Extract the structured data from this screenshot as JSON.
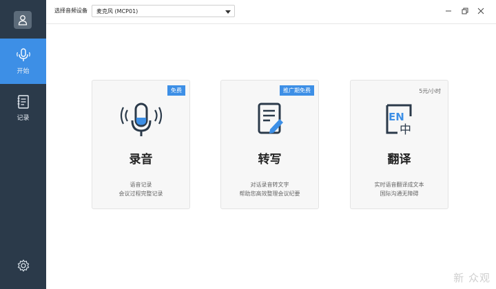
{
  "header": {
    "device_label": "选择音频设备",
    "device_value": "麦克风 (MCP01)"
  },
  "sidebar": {
    "items": [
      {
        "label": "开始",
        "icon": "microphone-icon",
        "active": true
      },
      {
        "label": "记录",
        "icon": "notes-icon",
        "active": false
      }
    ]
  },
  "cards": [
    {
      "title": "录音",
      "badge": "免费",
      "desc_line1": "语音记录",
      "desc_line2": "会议过程完整记录",
      "icon": "microphone-icon"
    },
    {
      "title": "转写",
      "badge": "推广期免费",
      "desc_line1": "对话录音转文字",
      "desc_line2": "帮助您高效整理会议纪要",
      "icon": "document-pen-icon"
    },
    {
      "title": "翻译",
      "price": "5元/小时",
      "desc_line1": "实时语音翻译成文本",
      "desc_line2": "国际沟通无障碍",
      "icon": "translate-icon",
      "icon_text_en": "EN",
      "icon_text_zh": "中"
    }
  ],
  "watermark": "新 众观",
  "colors": {
    "sidebar": "#2b3a4a",
    "accent": "#3d8fe6"
  }
}
